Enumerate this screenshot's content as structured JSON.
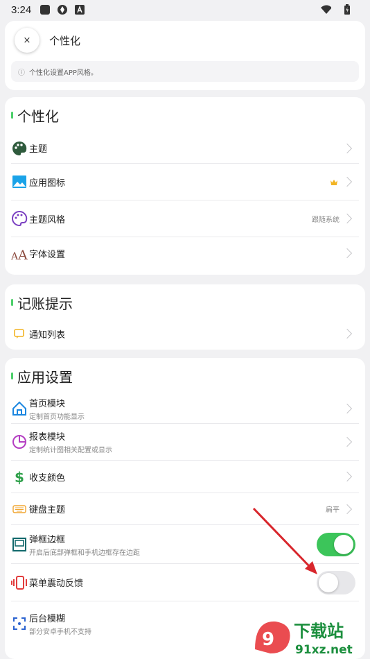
{
  "status_bar": {
    "time": "3:24"
  },
  "header": {
    "back_label": "×",
    "title": "个性化",
    "info_text": "个性化设置APP风格。",
    "info_icon": "ⓘ"
  },
  "sections": [
    {
      "title": "个性化",
      "items": [
        {
          "title": "主题",
          "icon": "palette-icon"
        },
        {
          "title": "应用图标",
          "icon": "image-icon",
          "badge": "crown-icon"
        },
        {
          "title": "主题风格",
          "icon": "palette-outline-icon",
          "value": "跟随系统"
        },
        {
          "title": "字体设置",
          "icon": "font-size-icon"
        }
      ]
    },
    {
      "title": "记账提示",
      "items": [
        {
          "title": "通知列表",
          "icon": "message-icon"
        }
      ]
    },
    {
      "title": "应用设置",
      "items": [
        {
          "title": "首页模块",
          "subtitle": "定制首页功能显示",
          "icon": "home-icon"
        },
        {
          "title": "报表模块",
          "subtitle": "定制统计图相关配置或显示",
          "icon": "pie-chart-icon"
        },
        {
          "title": "收支颜色",
          "icon": "dollar-icon"
        },
        {
          "title": "键盘主题",
          "icon": "keyboard-icon",
          "value": "扁平"
        },
        {
          "title": "弹框边框",
          "subtitle": "开启后底部弹框和手机边框存在边距",
          "icon": "frame-icon",
          "toggle": "on"
        },
        {
          "title": "菜单震动反馈",
          "icon": "vibrate-icon",
          "toggle": "off"
        },
        {
          "title": "后台模糊",
          "subtitle": "部分安卓手机不支持",
          "icon": "blur-icon"
        }
      ]
    }
  ],
  "watermark": {
    "text1": "下载站",
    "text2": "91xz.net"
  },
  "colors": {
    "accent_green": "#3cc55a",
    "arrow_red": "#d8262c"
  }
}
